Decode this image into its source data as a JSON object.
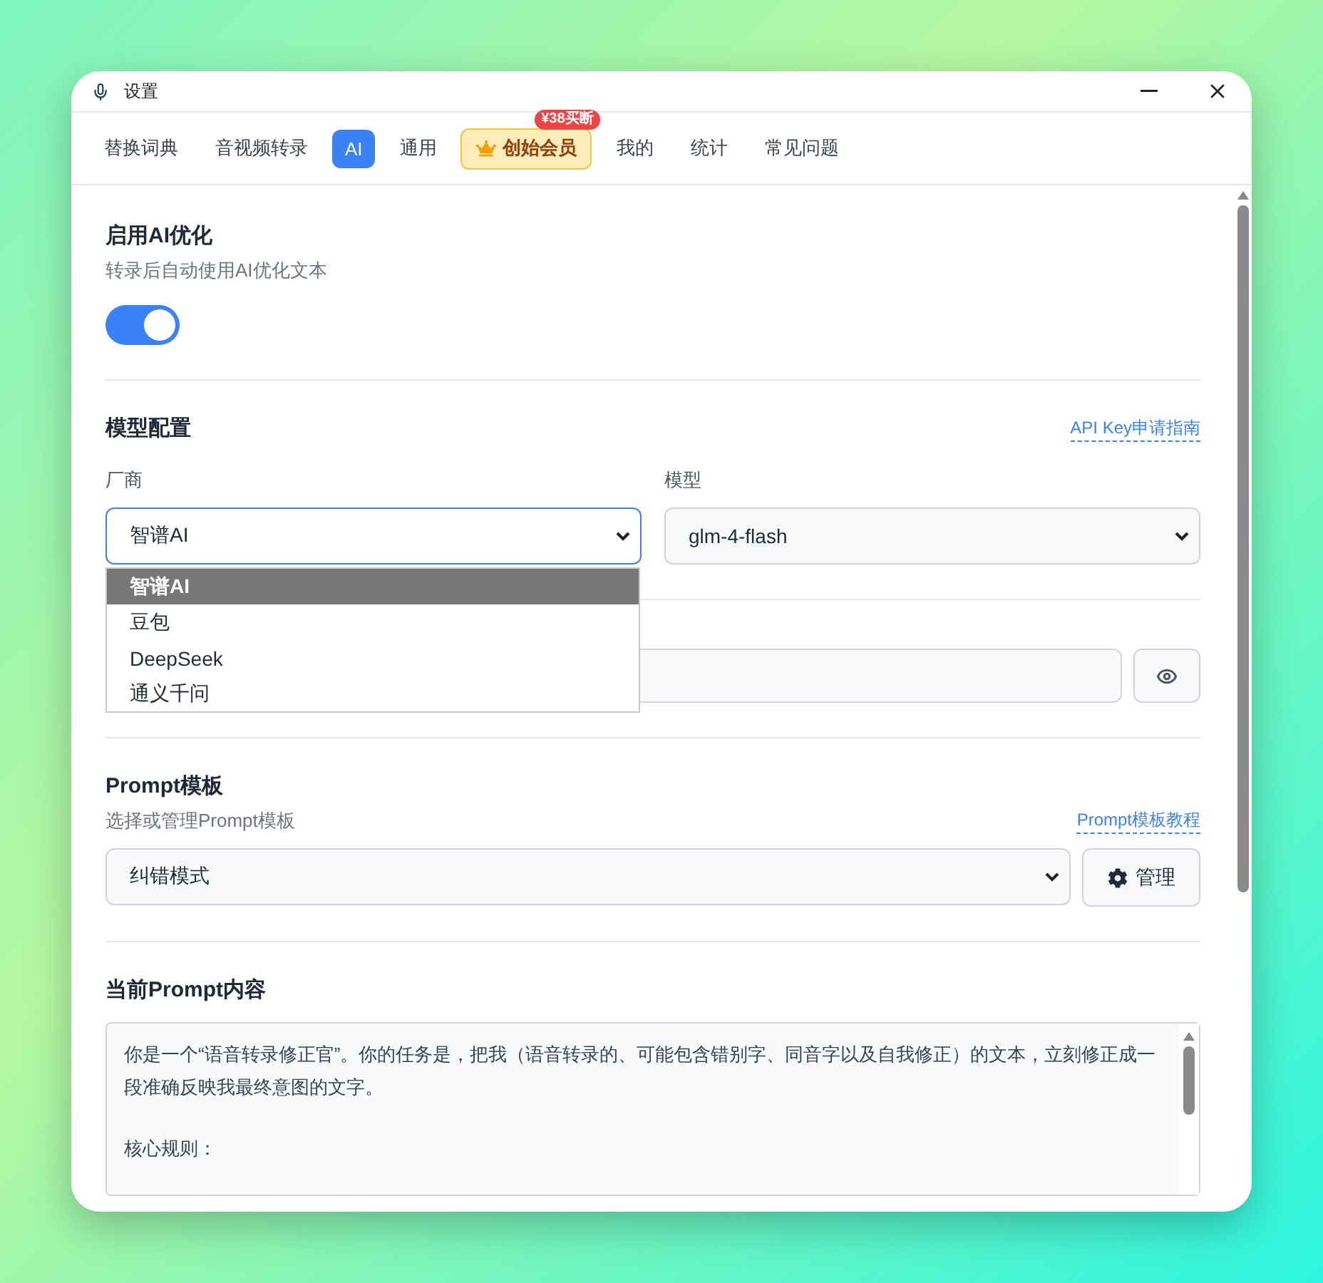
{
  "window": {
    "title": "设置"
  },
  "tabs": [
    {
      "label": "替换词典",
      "selected": false,
      "kind": "plain"
    },
    {
      "label": "音视频转录",
      "selected": false,
      "kind": "plain"
    },
    {
      "label": "AI",
      "selected": true,
      "kind": "plain"
    },
    {
      "label": "通用",
      "selected": false,
      "kind": "plain"
    },
    {
      "label": "创始会员",
      "selected": false,
      "kind": "member",
      "badge": "¥38买断"
    },
    {
      "label": "我的",
      "selected": false,
      "kind": "plain"
    },
    {
      "label": "统计",
      "selected": false,
      "kind": "plain"
    },
    {
      "label": "常见问题",
      "selected": false,
      "kind": "plain"
    }
  ],
  "ai_optimization": {
    "title": "启用AI优化",
    "description": "转录后自动使用AI优化文本",
    "on": true
  },
  "model_config": {
    "title": "模型配置",
    "link": "API Key申请指南",
    "vendor_label": "厂商",
    "vendor_value": "智谱AI",
    "model_label": "模型",
    "model_value": "glm-4-flash",
    "vendor_options": [
      {
        "label": "智谱AI",
        "selected": true
      },
      {
        "label": "豆包",
        "selected": false
      },
      {
        "label": "DeepSeek",
        "selected": false
      },
      {
        "label": "通义千问",
        "selected": false
      }
    ]
  },
  "prompt_template": {
    "title": "Prompt模板",
    "description": "选择或管理Prompt模板",
    "link": "Prompt模板教程",
    "value": "纠错模式",
    "manage_button": "管理"
  },
  "current_prompt": {
    "title": "当前Prompt内容",
    "paragraphs": [
      "你是一个“语音转录修正官”。你的任务是，把我（语音转录的、可能包含错别字、同音字以及自我修正）的文本，立刻修正成一段准确反映我最终意图的文字。",
      "核心规则："
    ]
  }
}
